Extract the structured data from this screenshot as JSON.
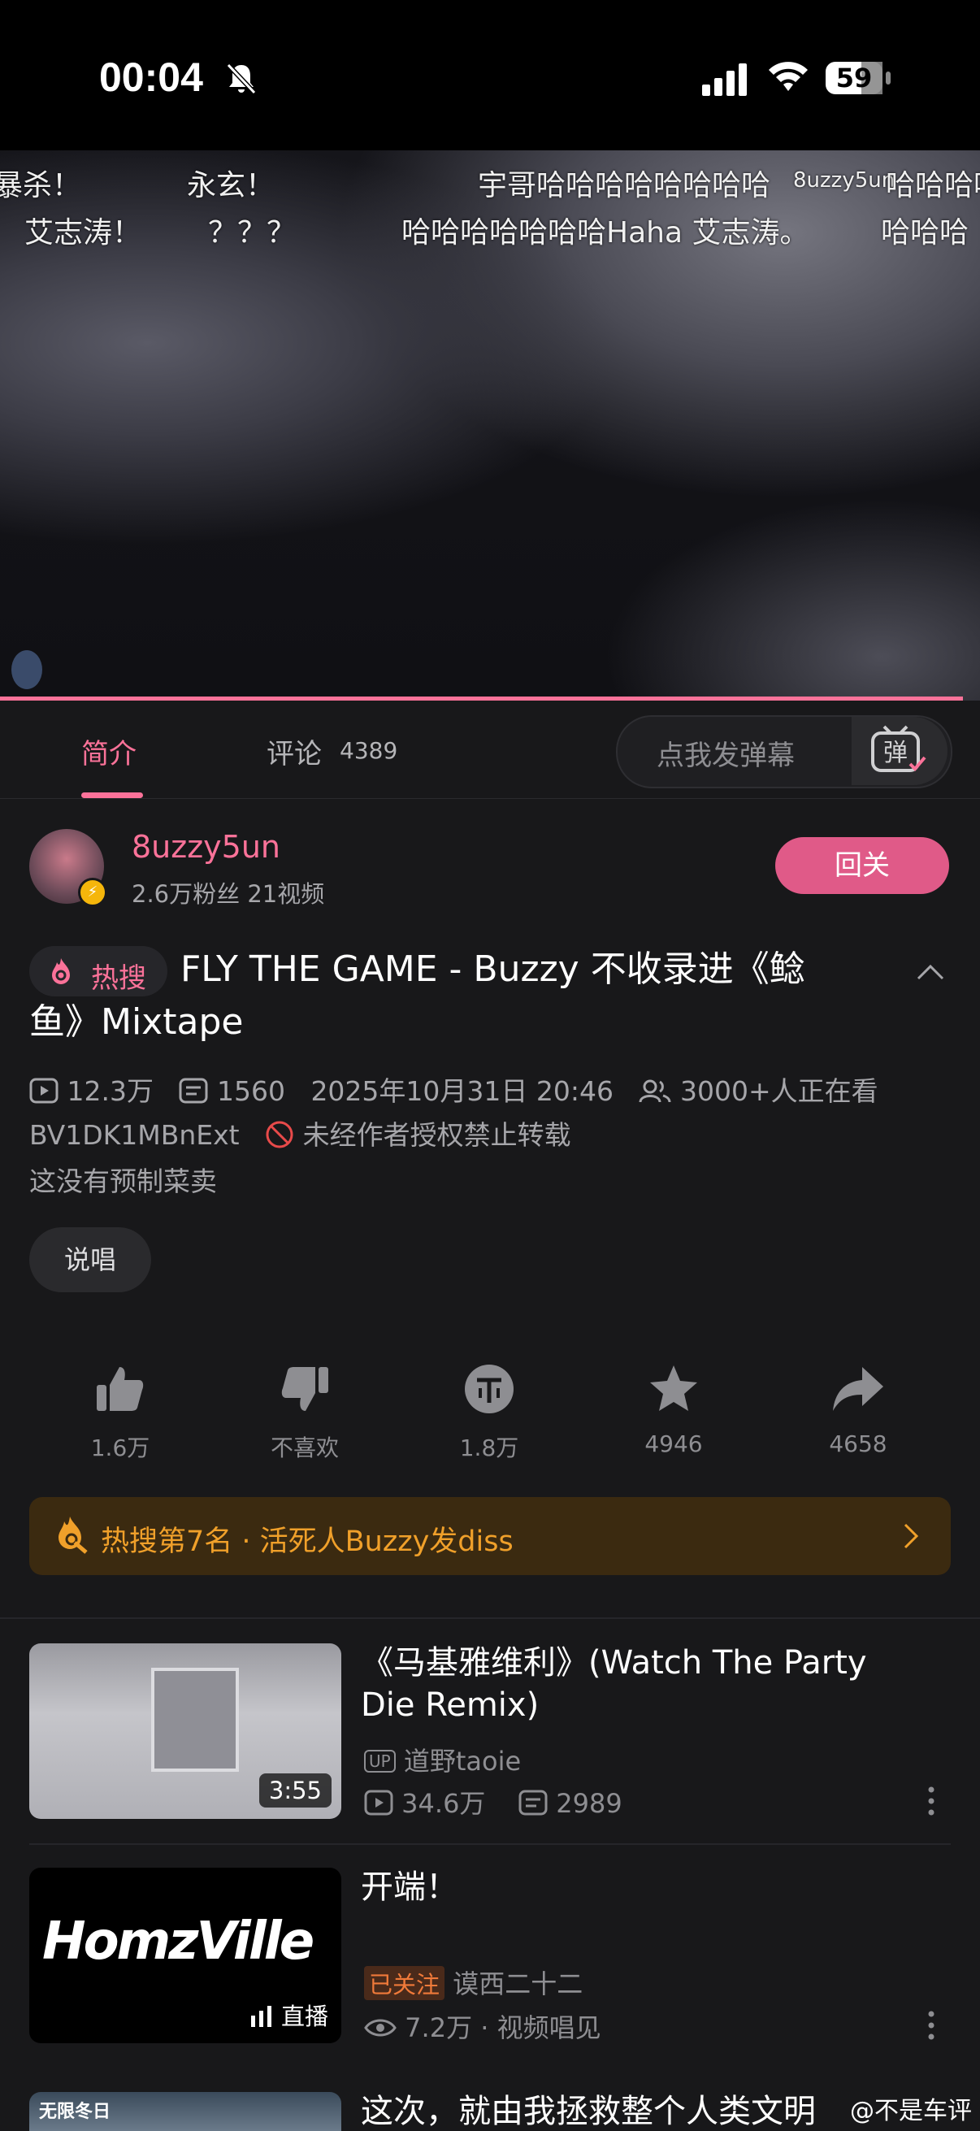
{
  "status_bar": {
    "time": "00:04",
    "battery": "59"
  },
  "player": {
    "danmaku": [
      "暴杀！",
      "永玄！",
      "宇哥哈哈哈哈哈哈哈哈",
      "8uzzy5un",
      "哈哈哈哈",
      "艾志涛！",
      "？？？",
      "哈哈哈哈哈哈哈Haha 艾志涛。",
      "哈哈哈"
    ],
    "progress": 0.983
  },
  "tabs": {
    "intro": "简介",
    "comments": "评论",
    "comments_count": "4389",
    "danmaku_placeholder": "点我发弹幕",
    "danmaku_button": "弹"
  },
  "uploader": {
    "name": "8uzzy5un",
    "stats": "2.6万粉丝  21视频",
    "follow_label": "回关"
  },
  "video": {
    "hot_label": "热搜",
    "title": "FLY THE GAME - Buzzy 不收录进《鲶鱼》Mixtape",
    "views": "12.3万",
    "danmaku_count": "1560",
    "date": "2025年10月31日 20:46",
    "watching": "3000+人正在看",
    "bvid": "BV1DK1MBnExt",
    "copyright": "未经作者授权禁止转载",
    "description": "这没有预制菜卖",
    "tag": "说唱"
  },
  "actions": [
    {
      "icon": "thumbs-up-icon",
      "label": "1.6万"
    },
    {
      "icon": "thumbs-down-icon",
      "label": "不喜欢"
    },
    {
      "icon": "coin-icon",
      "label": "1.8万"
    },
    {
      "icon": "star-icon",
      "label": "4946"
    },
    {
      "icon": "share-icon",
      "label": "4658"
    }
  ],
  "hot_banner": {
    "text": "热搜第7名 · 活死人Buzzy发diss"
  },
  "recommendations": [
    {
      "title": "《马基雅维利》(Watch The Party Die Remix)",
      "duration": "3:55",
      "up_badge": "UP",
      "author": "道野taoie",
      "views": "34.6万",
      "danmaku": "2989"
    },
    {
      "title": "开端！",
      "live_label": "直播",
      "thumb_text": "HomzVille",
      "followed_badge": "已关注",
      "author": "谟西二十二",
      "views": "7.2万",
      "category": "· 视频唱见"
    },
    {
      "title": "这次，就由我拯救整个人类文明",
      "thumb_text": "无限冬日"
    }
  ],
  "watermark": "@不是车评"
}
